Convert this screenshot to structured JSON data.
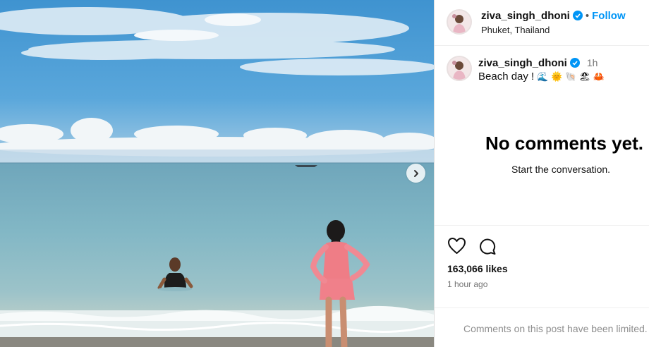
{
  "post": {
    "username": "ziva_singh_dhoni",
    "follow_label": "Follow",
    "location": "Phuket, Thailand",
    "caption_time": "1h",
    "caption_text": "Beach day ! ",
    "caption_emojis": [
      "wave-emoji",
      "sun-emoji",
      "shell-emoji",
      "beach-emoji",
      "crab-emoji"
    ],
    "caption_emoji_chars": "🌊 🌞 🐚 🏖 🦀"
  },
  "comments": {
    "empty_title": "No comments yet.",
    "empty_subtitle": "Start the conversation."
  },
  "stats": {
    "likes": "163,066 likes",
    "time_ago": "1 hour ago"
  },
  "footer": {
    "comments_limited": "Comments on this post have been limited."
  },
  "colors": {
    "accent": "#0095f6",
    "verified": "#0095f6",
    "sky": "#4d9ed4",
    "sea": "#7db5c6"
  }
}
